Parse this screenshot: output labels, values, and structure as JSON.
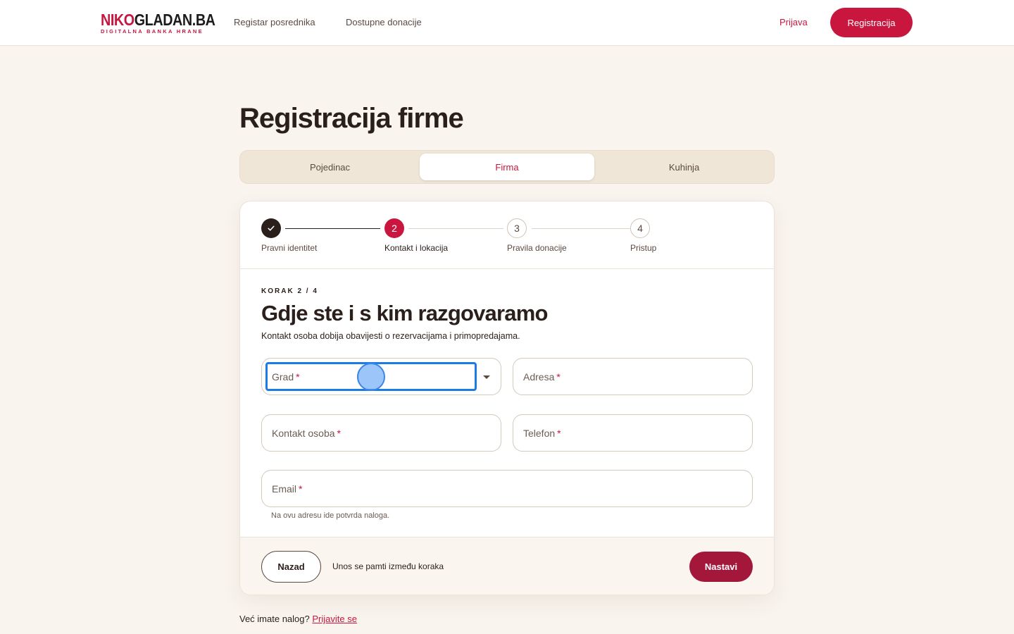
{
  "header": {
    "logo": {
      "part_red": "NIKO",
      "part_dark": "GLADAN.BA",
      "subtitle": "DIGITALNA BANKA HRANE"
    },
    "nav": [
      "Registar posrednika",
      "Dostupne donacije"
    ],
    "login_label": "Prijava",
    "register_label": "Registracija"
  },
  "page": {
    "title": "Registracija firme",
    "type_tabs": [
      {
        "label": "Pojedinac",
        "active": false
      },
      {
        "label": "Firma",
        "active": true
      },
      {
        "label": "Kuhinja",
        "active": false
      }
    ]
  },
  "stepper": {
    "steps": [
      {
        "label": "Pravni identitet",
        "state": "done",
        "icon": "check-icon"
      },
      {
        "label": "Kontakt i lokacija",
        "state": "current",
        "number": "2"
      },
      {
        "label": "Pravila donacije",
        "state": "todo",
        "number": "3"
      },
      {
        "label": "Pristup",
        "state": "todo",
        "number": "4"
      }
    ]
  },
  "form": {
    "eyebrow": "KORAK 2 / 4",
    "title": "Gdje ste i s kim razgovaramo",
    "description": "Kontakt osoba dobija obavijesti o rezervacijama i primopredajama.",
    "required_mark": "*",
    "fields": {
      "city": {
        "label": "Grad",
        "type": "select",
        "focused": true,
        "value": ""
      },
      "address": {
        "label": "Adresa",
        "value": ""
      },
      "contact_person": {
        "label": "Kontakt osoba",
        "value": ""
      },
      "phone": {
        "label": "Telefon",
        "value": ""
      },
      "email": {
        "label": "Email",
        "value": "",
        "hint": "Na ovu adresu ide potvrda naloga."
      }
    }
  },
  "footer": {
    "back_label": "Nazad",
    "save_note": "Unos se pamti između koraka",
    "next_label": "Nastavi"
  },
  "bottom": {
    "text": "Već imate nalog?",
    "link": "Prijavite se"
  },
  "colors": {
    "brand": "#c8163f",
    "brand_dark": "#a3183a",
    "background": "#f9f4ee",
    "focus": "#1d7be5"
  }
}
